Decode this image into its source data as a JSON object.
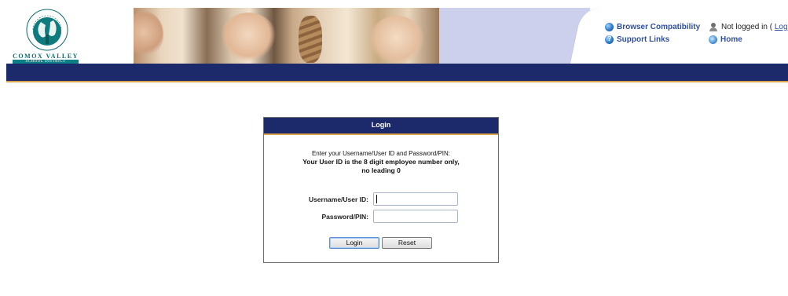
{
  "logo": {
    "arc_text": "COMMUNITY OF LEARNERS",
    "name": "COMOX VALLEY",
    "subtitle": "SCHOOL DISTRICT"
  },
  "header": {
    "links": [
      {
        "label": "Browser Compatibility",
        "icon": "globe-icon"
      },
      {
        "label": "Support Links",
        "icon": "help-icon"
      }
    ],
    "status_text": "Not logged in (",
    "status_login": "Login",
    "home_label": "Home"
  },
  "colors": {
    "nav_bar": "#1c2a6b",
    "accent_line": "#d9a44a",
    "link": "#2f4f9e",
    "header_panel": "#cdd0ec"
  },
  "login_panel": {
    "title": "Login",
    "instruction": "Enter your Username/User ID and Password/PIN:",
    "note_line1": "Your User ID is the 8 digit employee number only,",
    "note_line2": "no leading 0",
    "username_label": "Username/User ID:",
    "username_value": "",
    "password_label": "Password/PIN:",
    "password_value": "",
    "login_button": "Login",
    "reset_button": "Reset"
  }
}
